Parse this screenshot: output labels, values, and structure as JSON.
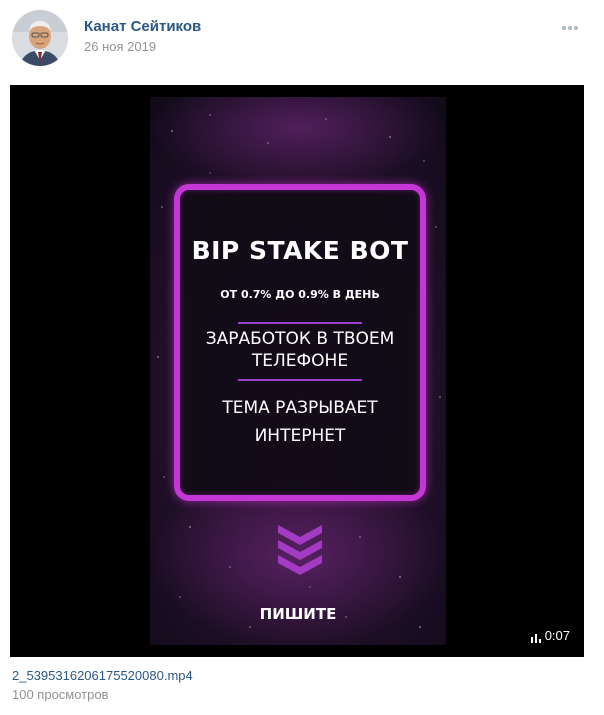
{
  "post": {
    "author_name": "Канат Сейтиков",
    "date": "26 ноя 2019",
    "more_icon": "more-dots-icon",
    "avatar_icon": "user-avatar"
  },
  "video": {
    "title": "BIP STAKE BOT",
    "rate": "ОТ 0.7% ДО 0.9% В ДЕНЬ",
    "line_1": "ЗАРАБОТОК В ТВОЕМ",
    "line_2": "ТЕЛЕФОНЕ",
    "line_3": "ТЕМА РАЗРЫВАЕТ",
    "line_4": "ИНТЕРНЕТ",
    "cta": "ПИШИТЕ",
    "duration": "0:07",
    "accent_color": "#c536d6",
    "background_color": "#1d0a22",
    "chevron_icon": "triple-chevron-down-icon",
    "duration_icon": "signal-bars-icon"
  },
  "attachment": {
    "file_name": "2_5395316206175520080.mp4",
    "views": "100 просмотров"
  },
  "colors": {
    "link": "#2a5885",
    "muted": "#939393"
  }
}
